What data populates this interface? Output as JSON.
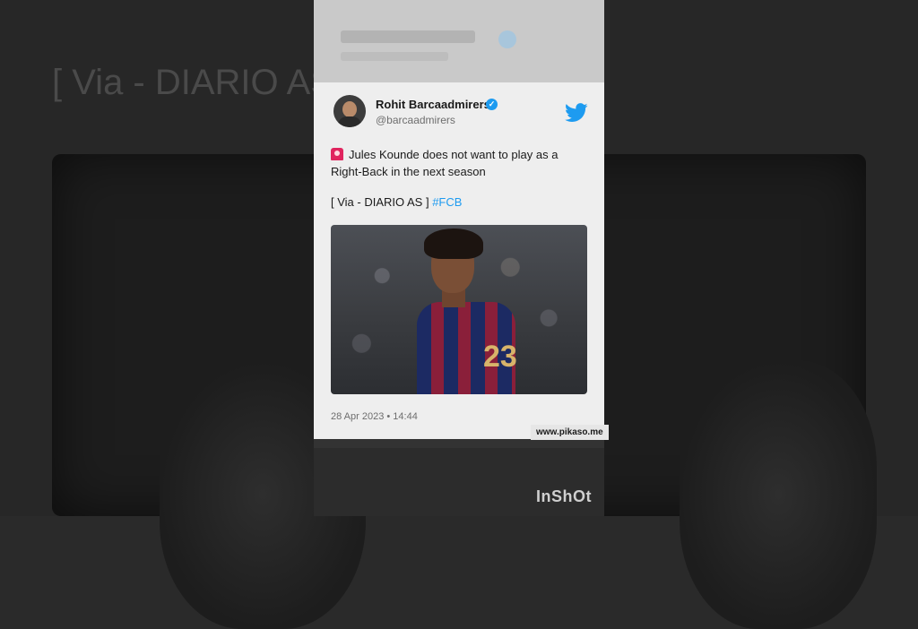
{
  "background": {
    "text": "[ Via - DIARIO AS"
  },
  "tweet": {
    "author_name": "Rohit Barcaadmirers",
    "author_handle": "@barcaadmirers",
    "text_line": "Jules Kounde does not want to play as a Right-Back in the next season",
    "via_text": "[ Via - DIARIO AS ]",
    "hashtag": "#FCB",
    "jersey_number": "23",
    "timestamp": "28 Apr 2023 • 14:44",
    "accent_color": "#1d9bf0"
  },
  "watermark": "www.pikaso.me",
  "app_watermark": "InShOt"
}
